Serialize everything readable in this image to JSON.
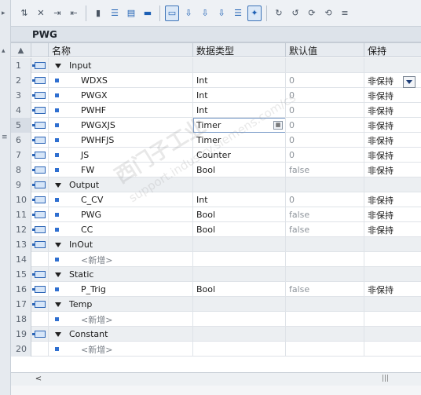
{
  "toolbar": {
    "icons": [
      "insert-row-icon",
      "delete-row-icon",
      "indent-icon",
      "outdent-icon",
      "monitor-icon",
      "view-1-icon",
      "view-2-icon",
      "view-3-icon",
      "comment-icon",
      "download-1-icon",
      "download-2-icon",
      "download-3-icon",
      "list-icon",
      "highlight-icon",
      "refresh-1-icon",
      "refresh-2-icon",
      "refresh-3-icon",
      "refresh-4-icon",
      "more-icon"
    ]
  },
  "block": {
    "title": "PWG"
  },
  "columns": {
    "name": "名称",
    "type": "数据类型",
    "default": "默认值",
    "retain": "保持"
  },
  "rows": [
    {
      "num": "1",
      "kind": "section",
      "name": "Input",
      "type": "",
      "default": "",
      "retain": ""
    },
    {
      "num": "2",
      "kind": "var",
      "name": "WDXS",
      "type": "Int",
      "default": "0",
      "retain": "非保持"
    },
    {
      "num": "3",
      "kind": "var",
      "name": "PWGX",
      "type": "Int",
      "default": "0",
      "retain": "非保持"
    },
    {
      "num": "4",
      "kind": "var",
      "name": "PWHF",
      "type": "Int",
      "default": "0",
      "retain": "非保持"
    },
    {
      "num": "5",
      "kind": "var",
      "name": "PWGXJS",
      "type": "Timer",
      "default": "0",
      "retain": "非保持"
    },
    {
      "num": "6",
      "kind": "var",
      "name": "PWHFJS",
      "type": "Timer",
      "default": "0",
      "retain": "非保持"
    },
    {
      "num": "7",
      "kind": "var",
      "name": "JS",
      "type": "Counter",
      "default": "0",
      "retain": "非保持"
    },
    {
      "num": "8",
      "kind": "var",
      "name": "FW",
      "type": "Bool",
      "default": "false",
      "retain": "非保持"
    },
    {
      "num": "9",
      "kind": "section",
      "name": "Output",
      "type": "",
      "default": "",
      "retain": ""
    },
    {
      "num": "10",
      "kind": "var",
      "name": "C_CV",
      "type": "Int",
      "default": "0",
      "retain": "非保持"
    },
    {
      "num": "11",
      "kind": "var",
      "name": "PWG",
      "type": "Bool",
      "default": "false",
      "retain": "非保持"
    },
    {
      "num": "12",
      "kind": "var",
      "name": "CC",
      "type": "Bool",
      "default": "false",
      "retain": "非保持"
    },
    {
      "num": "13",
      "kind": "section",
      "name": "InOut",
      "type": "",
      "default": "",
      "retain": ""
    },
    {
      "num": "14",
      "kind": "add",
      "name": "<新增>",
      "type": "",
      "default": "",
      "retain": ""
    },
    {
      "num": "15",
      "kind": "section",
      "name": "Static",
      "type": "",
      "default": "",
      "retain": ""
    },
    {
      "num": "16",
      "kind": "var",
      "name": "P_Trig",
      "type": "Bool",
      "default": "false",
      "retain": "非保持"
    },
    {
      "num": "17",
      "kind": "section",
      "name": "Temp",
      "type": "",
      "default": "",
      "retain": ""
    },
    {
      "num": "18",
      "kind": "add",
      "name": "<新增>",
      "type": "",
      "default": "",
      "retain": ""
    },
    {
      "num": "19",
      "kind": "section",
      "name": "Constant",
      "type": "",
      "default": "",
      "retain": ""
    },
    {
      "num": "20",
      "kind": "add",
      "name": "<新增>",
      "type": "",
      "default": "",
      "retain": ""
    }
  ],
  "selected_row": "5",
  "watermark": {
    "line1": "西门子工业",
    "line2": "support.industry.siemens.com/cs"
  }
}
